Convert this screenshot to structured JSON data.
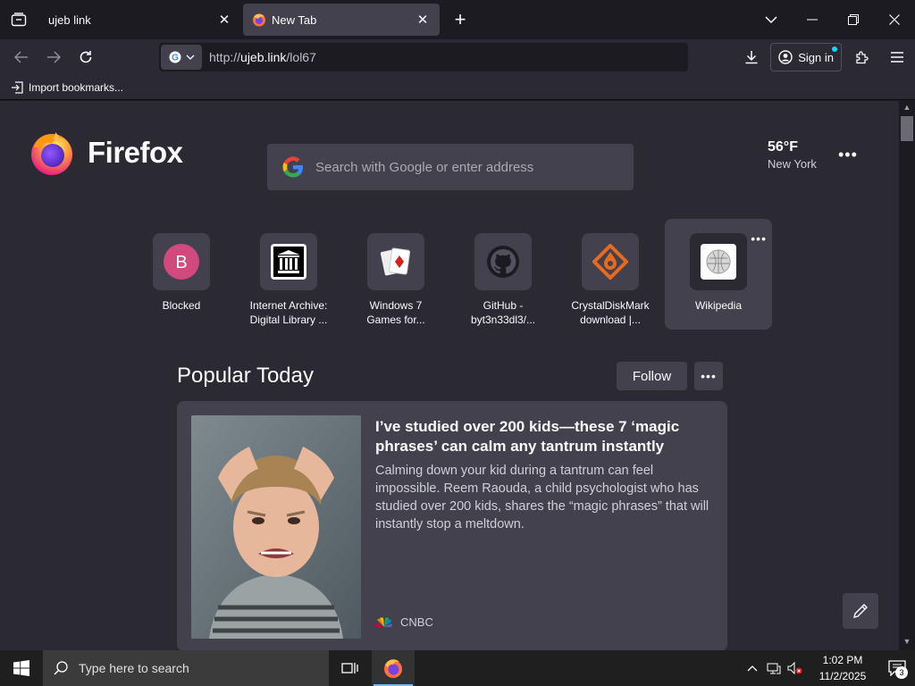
{
  "tabs": [
    {
      "title": "ujeb link",
      "active": false
    },
    {
      "title": "New Tab",
      "active": true
    }
  ],
  "navbar": {
    "url_scheme": "http://",
    "url_domain": "ujeb.link",
    "url_path": "/lol67",
    "signin_label": "Sign in"
  },
  "bookmarks": {
    "import_label": "Import bookmarks..."
  },
  "newtab": {
    "logo_text": "Firefox",
    "search_placeholder": "Search with Google or enter address",
    "weather": {
      "temp": "56°F",
      "city": "New York"
    },
    "shortcuts": [
      {
        "line1": "Blocked",
        "line2": "",
        "letter": "B"
      },
      {
        "line1": "Internet Archive:",
        "line2": "Digital Library ..."
      },
      {
        "line1": "Windows 7",
        "line2": "Games for..."
      },
      {
        "line1": "GitHub -",
        "line2": "byt3n33dl3/..."
      },
      {
        "line1": "CrystalDiskMark",
        "line2": "download |..."
      },
      {
        "line1": "Wikipedia",
        "line2": ""
      }
    ],
    "popular": {
      "title": "Popular Today",
      "follow_label": "Follow",
      "card": {
        "headline": "I’ve studied over 200 kids—these 7 ‘magic phrases’ can calm any tantrum instantly",
        "excerpt": "Calming down your kid during a tantrum can feel impossible. Reem Raouda, a child psychologist who has studied over 200 kids, shares the “magic phrases” that will instantly stop a meltdown.",
        "source": "CNBC"
      }
    }
  },
  "taskbar": {
    "search_placeholder": "Type here to search",
    "time": "1:02 PM",
    "date": "11/2/2025",
    "notification_count": "3"
  },
  "colors": {
    "accent": "#00ddff",
    "background": "#2b2a33",
    "card": "#42414d"
  }
}
